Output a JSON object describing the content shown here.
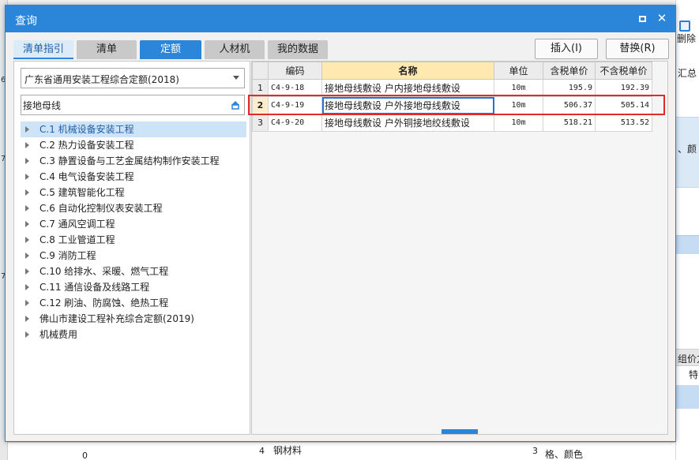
{
  "dialog": {
    "title": "查询",
    "maximize_label": "□",
    "close_label": "✕"
  },
  "tabs": [
    {
      "label": "清单指引"
    },
    {
      "label": "清单"
    },
    {
      "label": "定额"
    },
    {
      "label": "人材机"
    },
    {
      "label": "我的数据"
    }
  ],
  "actions": {
    "insert_label": "插入(I)",
    "replace_label": "替换(R)"
  },
  "library": {
    "selected": "广东省通用安装工程综合定额(2018)"
  },
  "search": {
    "value": "接地母线"
  },
  "tree": [
    {
      "label": "C.1 机械设备安装工程"
    },
    {
      "label": "C.2 热力设备安装工程"
    },
    {
      "label": "C.3 静置设备与工艺金属结构制作安装工程"
    },
    {
      "label": "C.4 电气设备安装工程"
    },
    {
      "label": "C.5 建筑智能化工程"
    },
    {
      "label": "C.6 自动化控制仪表安装工程"
    },
    {
      "label": "C.7 通风空调工程"
    },
    {
      "label": "C.8 工业管道工程"
    },
    {
      "label": "C.9 消防工程"
    },
    {
      "label": "C.10 给排水、采暖、燃气工程"
    },
    {
      "label": "C.11 通信设备及线路工程"
    },
    {
      "label": "C.12 刷油、防腐蚀、绝热工程"
    },
    {
      "label": "佛山市建设工程补充综合定额(2019)"
    },
    {
      "label": "机械费用"
    }
  ],
  "grid": {
    "headers": {
      "code": "编码",
      "name": "名称",
      "unit": "单位",
      "tax_price": "含税单价",
      "notax_price": "不含税单价"
    },
    "rows": [
      {
        "no": "1",
        "code": "C4-9-18",
        "name": "接地母线敷设 户内接地母线敷设",
        "unit": "10m",
        "tax_price": "195.9",
        "notax_price": "192.39"
      },
      {
        "no": "2",
        "code": "C4-9-19",
        "name": "接地母线敷设 户外接地母线敷设",
        "unit": "10m",
        "tax_price": "506.37",
        "notax_price": "505.14"
      },
      {
        "no": "3",
        "code": "C4-9-20",
        "name": "接地母线敷设 户外铜接地绞线敷设",
        "unit": "10m",
        "tax_price": "518.21",
        "notax_price": "513.52"
      }
    ]
  },
  "background": {
    "left_marks": [
      "6",
      "7",
      "7"
    ],
    "delete_label": "删除",
    "right_text_a": "汇总",
    "right_text_b": "、颜",
    "right_text_c": "组价方",
    "right_text_d": "特",
    "bottom_num_a": "0",
    "bottom_num_b": "4",
    "bottom_text_a": "钢材料",
    "bottom_num_c": "3",
    "bottom_text_b": "格、颜色"
  },
  "colors": {
    "accent": "#2b85d8",
    "highlight": "#e02b2b"
  }
}
